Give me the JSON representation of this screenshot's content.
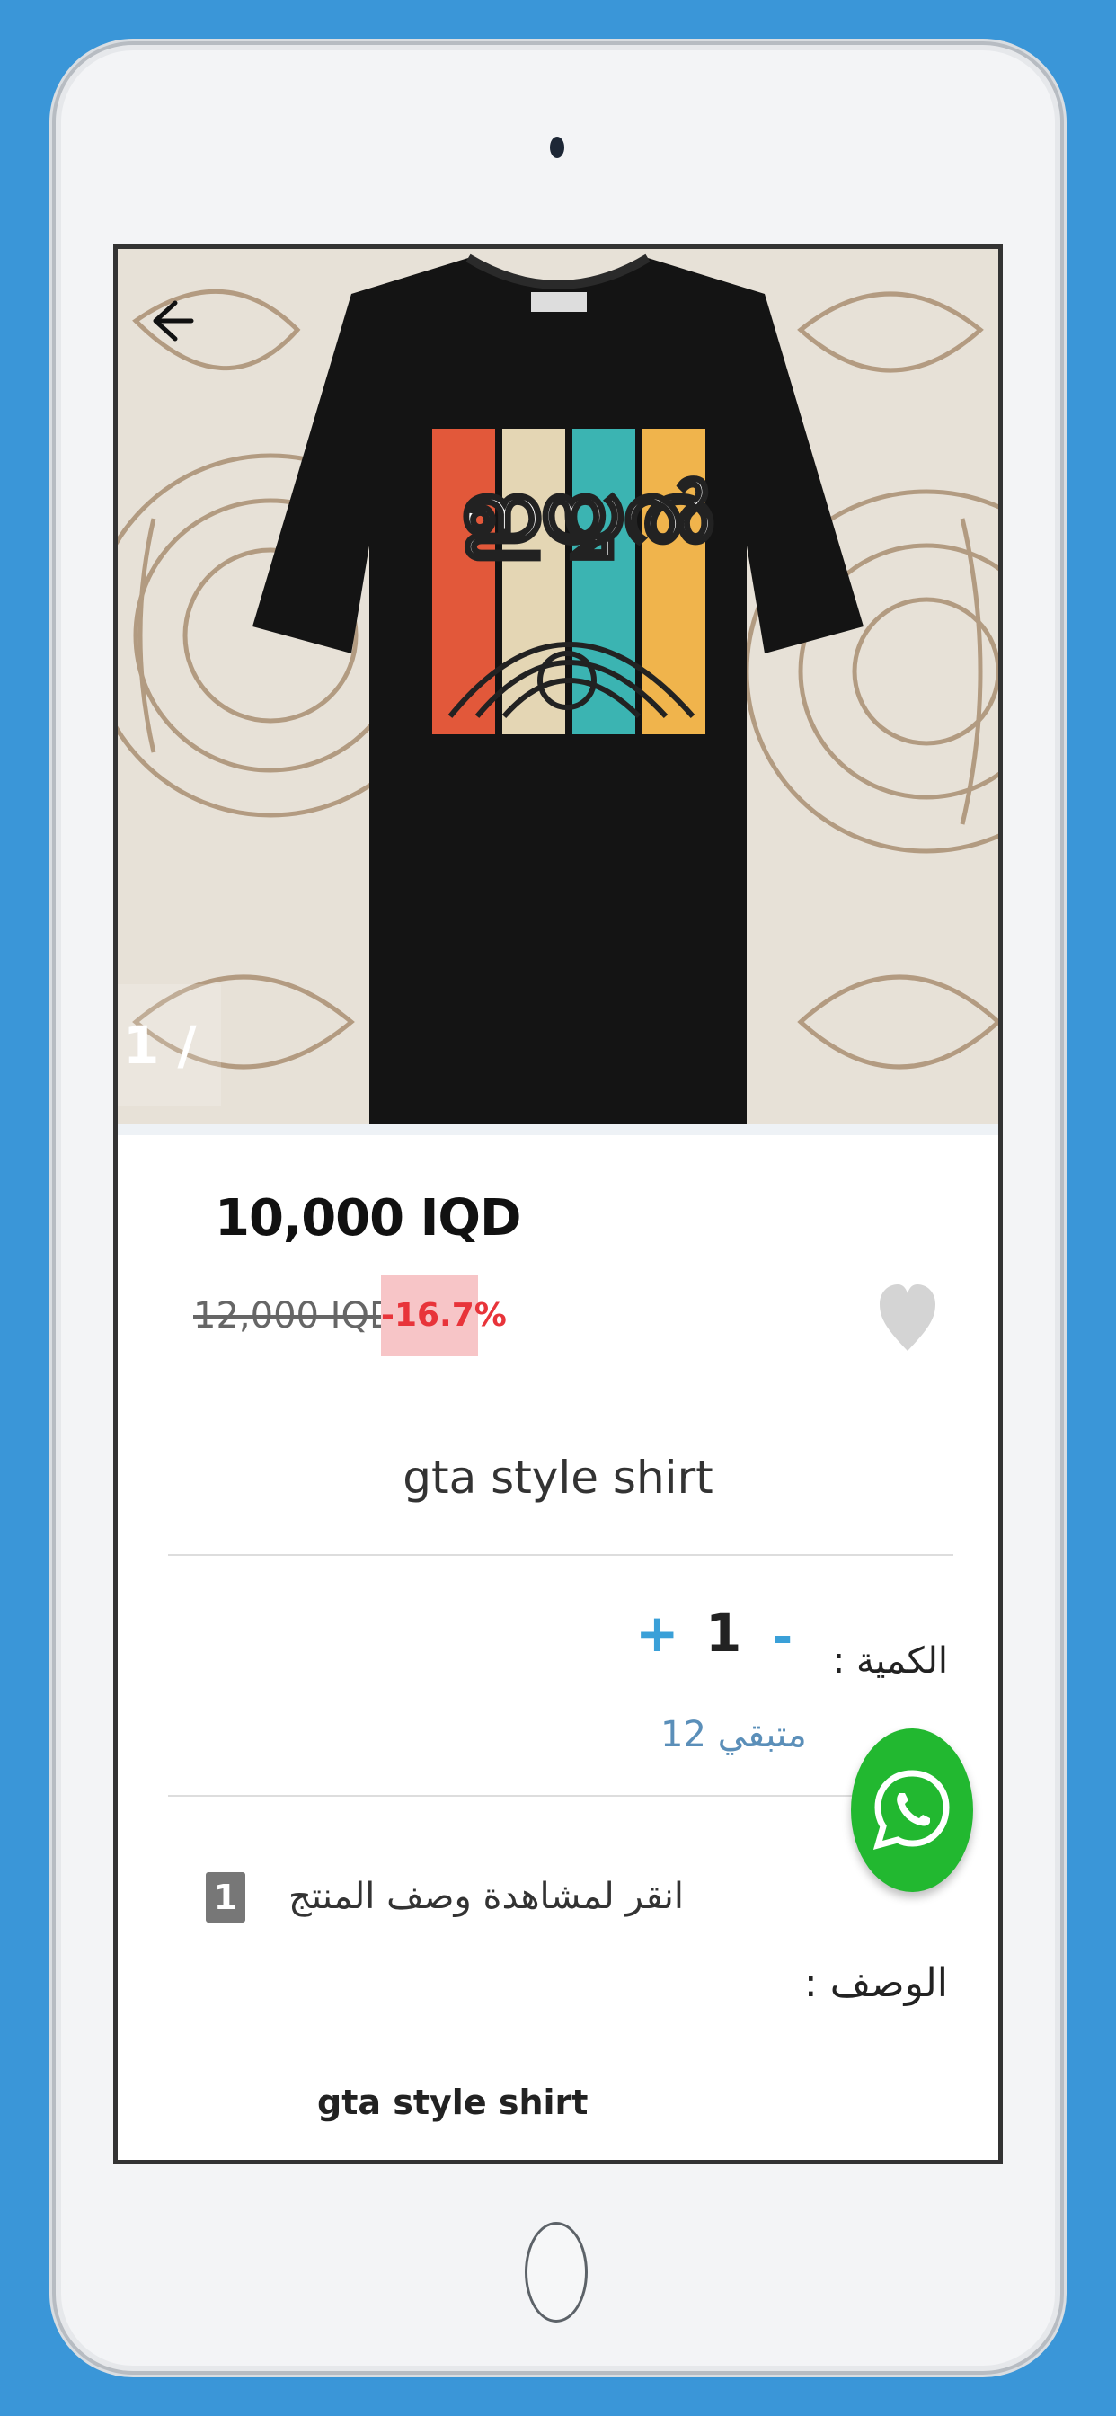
{
  "product": {
    "image_counter": "1 / 1",
    "price": "10,000 IQD",
    "old_price": "12,000 IQD",
    "discount": "-16.7%",
    "title": "gta style shirt"
  },
  "quantity": {
    "label": "الكمية :",
    "minus": "-",
    "value": "1",
    "plus": "+",
    "stock": "متبقي 12"
  },
  "description": {
    "toggle_icon": "1",
    "toggle_text": "انقر لمشاهدة وصف المنتج",
    "label": "الوصف :",
    "value": "gta style shirt"
  },
  "icons": {
    "back": "back-arrow-icon",
    "heart": "heart-icon",
    "whatsapp": "whatsapp-icon"
  },
  "colors": {
    "accent": "#3aa0d8",
    "discount_bg": "#f7c5c7",
    "discount_text": "#e8343a",
    "whatsapp": "#22b830",
    "background": "#3a96d8"
  }
}
